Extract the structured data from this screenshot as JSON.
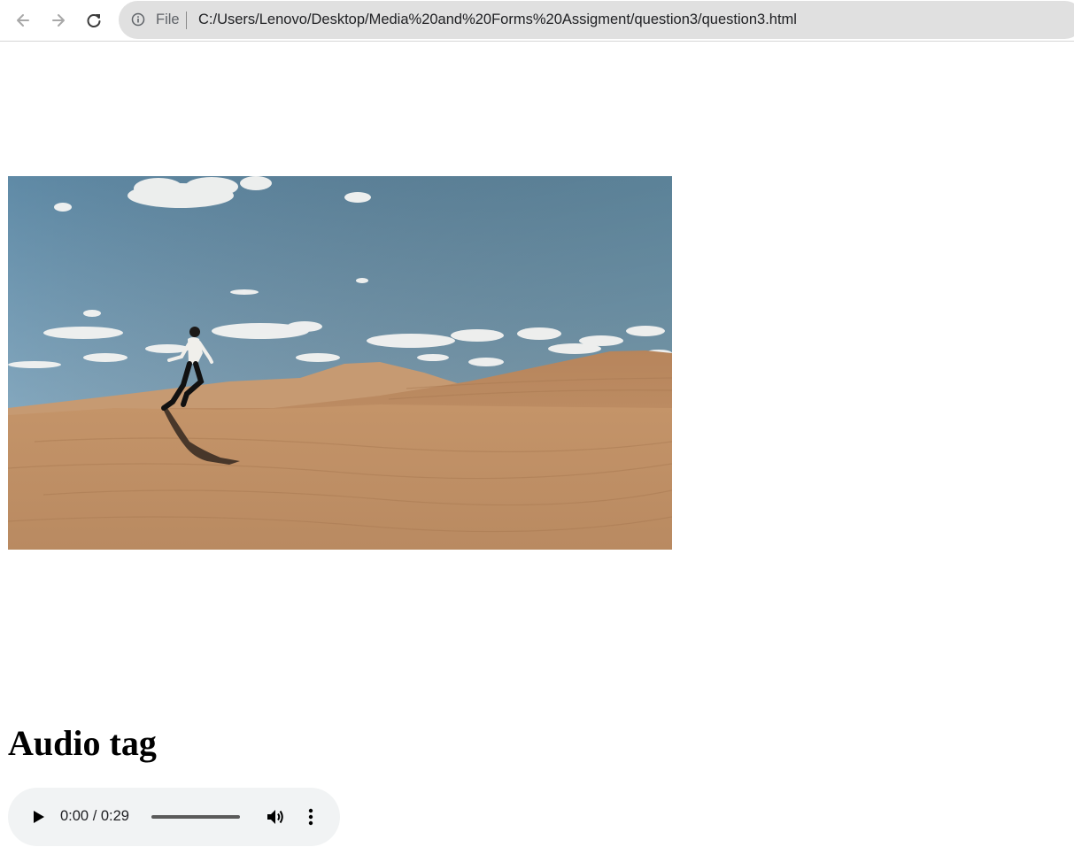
{
  "browser": {
    "scheme_label": "File",
    "url": "C:/Users/Lenovo/Desktop/Media%20and%20Forms%20Assigment/question3/question3.html",
    "back_icon": "arrow-left-icon",
    "forward_icon": "arrow-right-icon",
    "reload_icon": "reload-icon",
    "info_icon": "info-icon"
  },
  "video": {
    "content": "desert-dunes-runner-video-frame"
  },
  "audio_section": {
    "heading": "Audio tag",
    "player": {
      "time": "0:00 / 0:29",
      "progress": 0,
      "play_icon": "play-icon",
      "volume_icon": "volume-icon",
      "more_icon": "more-vertical-icon"
    }
  },
  "colors": {
    "omnibox_bg": "#e0e0e0",
    "player_bg": "#f1f3f4",
    "sky": "#6d95b0",
    "sand": "#c4956a"
  }
}
